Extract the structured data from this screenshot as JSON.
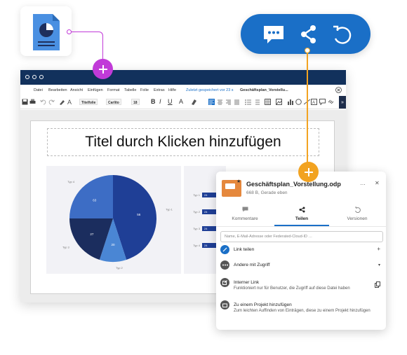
{
  "window": {
    "menu": [
      "Datei",
      "Bearbeiten",
      "Ansicht",
      "Einfügen",
      "Format",
      "Tabelle",
      "Folie",
      "Extras",
      "Hilfe"
    ],
    "autosave_status": "Zuletzt gespeichert vor 23 s",
    "doc_tab": "Geschäftsplan_Vorstellu...",
    "toolbar": {
      "style_dropdown": "Titelfolie",
      "font_dropdown": "Carlito",
      "size_dropdown": "18",
      "bold": "B",
      "italic": "I",
      "underline": "U",
      "fontcolor": "A"
    },
    "sidebar_toggle": "»"
  },
  "slide": {
    "title": "Titel durch Klicken hinzufügen"
  },
  "chart_data": [
    {
      "type": "pie",
      "values": [
        45,
        10,
        20,
        25
      ],
      "colors": [
        "#1f3f96",
        "#4a86d4",
        "#1b2d5e",
        "#3d6dc5"
      ],
      "labels": [
        "Typ 1",
        "Typ 2",
        "Typ 3",
        "Typ 4"
      ],
      "data_labels": [
        "56",
        "20",
        "27",
        "63"
      ]
    },
    {
      "type": "bar",
      "categories": [
        "Typ 1",
        "Typ 2",
        "Typ 3",
        "Typ 4"
      ],
      "values": [
        24,
        24,
        24,
        24
      ]
    }
  ],
  "share_panel": {
    "file_name": "Geschäftsplan_Vorstellung.odp",
    "file_meta": "668 B, Gerade eben",
    "more_icon": "…",
    "close_icon": "✕",
    "tabs": [
      {
        "label": "Kommentare",
        "icon": "comment-icon"
      },
      {
        "label": "Teilen",
        "icon": "share-icon"
      },
      {
        "label": "Versionen",
        "icon": "history-icon"
      }
    ],
    "search_placeholder": "Name, E-Mail-Adresse oder Federated-Cloud-ID …",
    "rows": [
      {
        "title": "Link teilen",
        "action": "+",
        "icon": "link-icon",
        "color": "#1a6fc7"
      },
      {
        "title": "Andere mit Zugriff",
        "action": "▾",
        "icon": "more-icon",
        "color": "#555555"
      },
      {
        "title": "Interner Link",
        "subtitle": "Funktioniert nur für Benutzer, die Zugriff auf diese Datei haben",
        "icon": "external-link-icon",
        "color": "#555555"
      },
      {
        "title": "Zu einem Projekt hinzufügen",
        "subtitle": "Zum leichten Auffinden von Einträgen, diese zu einem Projekt hinzufügen",
        "icon": "project-icon",
        "color": "#555555"
      }
    ]
  },
  "colors": {
    "brand_blue": "#1a6fc7",
    "accent_pink": "#c13ad8",
    "accent_orange": "#f2a321",
    "titlebar": "#12315c"
  }
}
